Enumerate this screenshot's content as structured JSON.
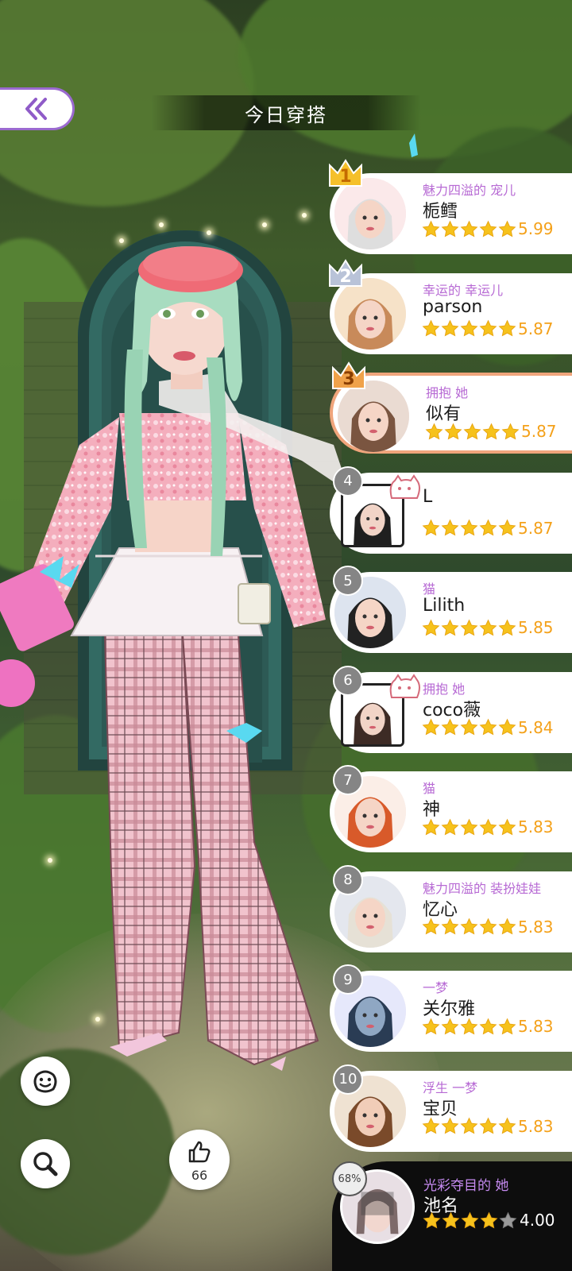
{
  "header": {
    "title": "今日穿搭"
  },
  "ranking": [
    {
      "rank": "1",
      "title": "魅力四溢的 宠儿",
      "name": "栀鳕",
      "score": "5.99",
      "stars": 5,
      "crown": "gold"
    },
    {
      "rank": "2",
      "title": "幸运的 幸运儿",
      "name": "parson",
      "score": "5.87",
      "stars": 5,
      "crown": "silver"
    },
    {
      "rank": "3",
      "title": "拥抱 她",
      "name": "似有",
      "score": "5.87",
      "stars": 5,
      "crown": "bronze",
      "highlight": true
    },
    {
      "rank": "4",
      "title": "",
      "name": "L",
      "score": "5.87",
      "stars": 5,
      "crown": "none"
    },
    {
      "rank": "5",
      "title": "猫",
      "name": "Lilith",
      "score": "5.85",
      "stars": 5,
      "crown": "none"
    },
    {
      "rank": "6",
      "title": "拥抱 她",
      "name": "coco薇",
      "score": "5.84",
      "stars": 5,
      "crown": "none"
    },
    {
      "rank": "7",
      "title": "猫",
      "name": "神",
      "score": "5.83",
      "stars": 5,
      "crown": "none"
    },
    {
      "rank": "8",
      "title": "魅力四溢的 装扮娃娃",
      "name": "忆心",
      "score": "5.83",
      "stars": 5,
      "crown": "none"
    },
    {
      "rank": "9",
      "title": "一梦",
      "name": "关尔雅",
      "score": "5.83",
      "stars": 5,
      "crown": "none"
    },
    {
      "rank": "10",
      "title": "浮生 一梦",
      "name": "宝贝",
      "score": "5.83",
      "stars": 5,
      "crown": "none"
    }
  ],
  "my_entry": {
    "percent": "68%",
    "title": "光彩夺目的 她",
    "name": "池名",
    "score": "4.00",
    "stars": 4
  },
  "like": {
    "count": "66"
  },
  "colors": {
    "accent": "#9b6ad0",
    "title_purple": "#b76ad4",
    "star": "#f6c21c",
    "score": "#f4a11a",
    "highlight_border": "#f0a57c"
  },
  "icons": {
    "back": "double-chevron-left-icon",
    "emoji": "smiley-icon",
    "search": "magnifier-icon",
    "like": "thumbs-up-icon"
  }
}
